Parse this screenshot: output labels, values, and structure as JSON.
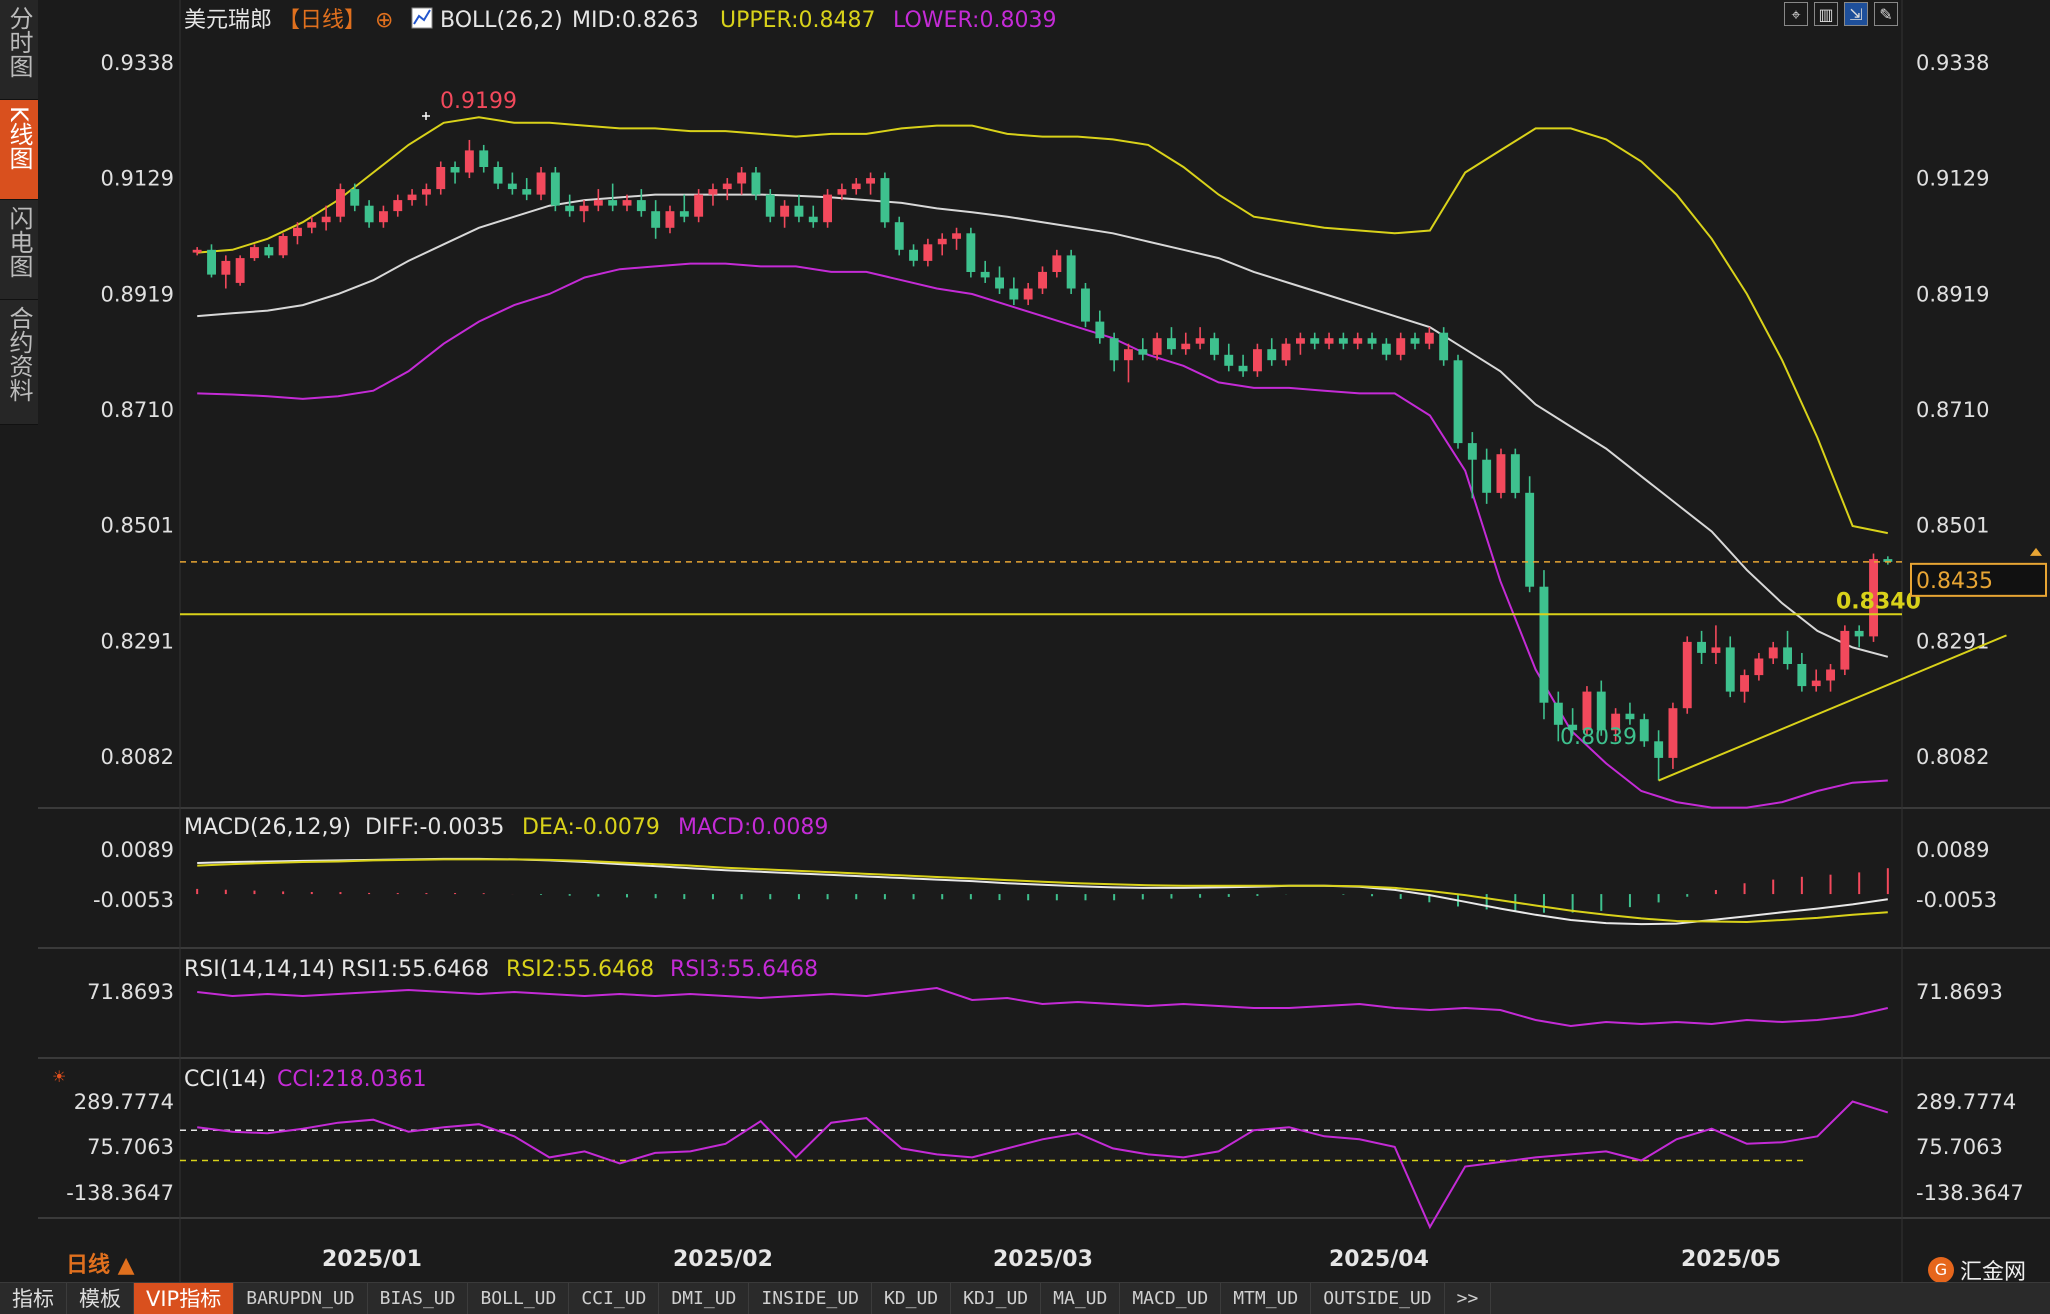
{
  "sidebar": {
    "tabs": [
      {
        "label": "分时图",
        "active": false
      },
      {
        "label": "K线图",
        "active": true
      },
      {
        "label": "闪电图",
        "active": false
      },
      {
        "label": "合约资料",
        "active": false
      }
    ]
  },
  "header": {
    "instrument": "美元瑞郎",
    "period": "【日线】",
    "boll_label": "BOLL(26,2)",
    "boll_mid": "MID:0.8263",
    "boll_upper": "UPPER:0.8487",
    "boll_lower": "LOWER:0.8039"
  },
  "price_axis": {
    "ticks": [
      "0.9338",
      "0.9129",
      "0.8919",
      "0.8710",
      "0.8501",
      "0.8291",
      "0.8082"
    ],
    "current_price": "0.8435",
    "hline_label": "0.8340",
    "high_label": "0.9199",
    "low_label": "0.8039"
  },
  "macd": {
    "title": "MACD(26,12,9)",
    "diff": "DIFF:-0.0035",
    "dea": "DEA:-0.0079",
    "macd": "MACD:0.0089",
    "ticks": [
      "0.0089",
      "-0.0053"
    ]
  },
  "rsi": {
    "title": "RSI(14,14,14)",
    "rsi1": "RSI1:55.6468",
    "rsi2": "RSI2:55.6468",
    "rsi3": "RSI3:55.6468",
    "tick": "71.8693"
  },
  "cci": {
    "title": "CCI(14)",
    "value": "CCI:218.0361",
    "ticks": [
      "289.7774",
      "75.7063",
      "-138.3647"
    ]
  },
  "time_axis": {
    "period_button": "日线 ▲",
    "labels": [
      "2025/01",
      "2025/02",
      "2025/03",
      "2025/04",
      "2025/05"
    ]
  },
  "bottom_bar": {
    "items": [
      "指标",
      "模板",
      "VIP指标",
      "BARUPDN_UD",
      "BIAS_UD",
      "BOLL_UD",
      "CCI_UD",
      "DMI_UD",
      "INSIDE_UD",
      "KD_UD",
      "KDJ_UD",
      "MA_UD",
      "MACD_UD",
      "MTM_UD",
      "OUTSIDE_UD",
      ">>"
    ],
    "active_index": 2
  },
  "logo": {
    "text": "汇金网"
  },
  "colors": {
    "up": "#f2495c",
    "down": "#3ec18e",
    "mid": "#d8d8d8",
    "upper": "#d9d21a",
    "lower": "#c42bd6",
    "accent": "#d9501e",
    "price_line": "#e8a534"
  },
  "chart_data": {
    "type": "candlestick",
    "title": "美元瑞郎 日线",
    "y_range": [
      0.7982,
      0.938
    ],
    "x_labels": [
      "2025/01",
      "2025/02",
      "2025/03",
      "2025/04",
      "2025/05"
    ],
    "candles": [
      [
        0.8995,
        0.9005,
        0.899,
        0.9
      ],
      [
        0.9,
        0.901,
        0.895,
        0.8955
      ],
      [
        0.8955,
        0.899,
        0.893,
        0.898
      ],
      [
        0.894,
        0.899,
        0.8935,
        0.8985
      ],
      [
        0.8985,
        0.901,
        0.898,
        0.9005
      ],
      [
        0.9005,
        0.901,
        0.8985,
        0.899
      ],
      [
        0.899,
        0.903,
        0.8985,
        0.9025
      ],
      [
        0.9025,
        0.905,
        0.901,
        0.904
      ],
      [
        0.904,
        0.906,
        0.903,
        0.905
      ],
      [
        0.905,
        0.908,
        0.9035,
        0.906
      ],
      [
        0.906,
        0.912,
        0.905,
        0.911
      ],
      [
        0.911,
        0.912,
        0.907,
        0.908
      ],
      [
        0.908,
        0.909,
        0.904,
        0.905
      ],
      [
        0.905,
        0.908,
        0.904,
        0.907
      ],
      [
        0.907,
        0.91,
        0.906,
        0.909
      ],
      [
        0.909,
        0.911,
        0.908,
        0.91
      ],
      [
        0.91,
        0.912,
        0.908,
        0.911
      ],
      [
        0.911,
        0.916,
        0.91,
        0.915
      ],
      [
        0.915,
        0.916,
        0.912,
        0.914
      ],
      [
        0.914,
        0.9199,
        0.913,
        0.918
      ],
      [
        0.918,
        0.919,
        0.914,
        0.915
      ],
      [
        0.915,
        0.916,
        0.911,
        0.912
      ],
      [
        0.912,
        0.914,
        0.91,
        0.911
      ],
      [
        0.911,
        0.913,
        0.909,
        0.91
      ],
      [
        0.91,
        0.915,
        0.909,
        0.914
      ],
      [
        0.914,
        0.915,
        0.907,
        0.908
      ],
      [
        0.908,
        0.91,
        0.906,
        0.907
      ],
      [
        0.907,
        0.909,
        0.905,
        0.908
      ],
      [
        0.908,
        0.911,
        0.907,
        0.909
      ],
      [
        0.909,
        0.912,
        0.907,
        0.908
      ],
      [
        0.908,
        0.91,
        0.907,
        0.909
      ],
      [
        0.909,
        0.911,
        0.906,
        0.907
      ],
      [
        0.907,
        0.909,
        0.902,
        0.904
      ],
      [
        0.904,
        0.908,
        0.903,
        0.907
      ],
      [
        0.907,
        0.91,
        0.905,
        0.906
      ],
      [
        0.906,
        0.911,
        0.905,
        0.91
      ],
      [
        0.91,
        0.912,
        0.908,
        0.911
      ],
      [
        0.911,
        0.913,
        0.909,
        0.912
      ],
      [
        0.912,
        0.915,
        0.91,
        0.914
      ],
      [
        0.914,
        0.915,
        0.909,
        0.91
      ],
      [
        0.91,
        0.911,
        0.905,
        0.906
      ],
      [
        0.906,
        0.909,
        0.904,
        0.908
      ],
      [
        0.908,
        0.91,
        0.905,
        0.906
      ],
      [
        0.906,
        0.908,
        0.904,
        0.905
      ],
      [
        0.905,
        0.911,
        0.904,
        0.91
      ],
      [
        0.91,
        0.912,
        0.909,
        0.911
      ],
      [
        0.911,
        0.913,
        0.91,
        0.912
      ],
      [
        0.912,
        0.914,
        0.91,
        0.913
      ],
      [
        0.913,
        0.914,
        0.904,
        0.905
      ],
      [
        0.905,
        0.906,
        0.899,
        0.9
      ],
      [
        0.9,
        0.901,
        0.897,
        0.898
      ],
      [
        0.898,
        0.902,
        0.897,
        0.901
      ],
      [
        0.901,
        0.903,
        0.899,
        0.902
      ],
      [
        0.902,
        0.904,
        0.9,
        0.903
      ],
      [
        0.903,
        0.904,
        0.895,
        0.896
      ],
      [
        0.896,
        0.898,
        0.894,
        0.895
      ],
      [
        0.895,
        0.897,
        0.892,
        0.893
      ],
      [
        0.893,
        0.895,
        0.89,
        0.891
      ],
      [
        0.891,
        0.894,
        0.89,
        0.893
      ],
      [
        0.893,
        0.897,
        0.892,
        0.896
      ],
      [
        0.896,
        0.9,
        0.895,
        0.899
      ],
      [
        0.899,
        0.9,
        0.892,
        0.893
      ],
      [
        0.893,
        0.894,
        0.886,
        0.887
      ],
      [
        0.887,
        0.889,
        0.883,
        0.884
      ],
      [
        0.884,
        0.885,
        0.878,
        0.88
      ],
      [
        0.88,
        0.883,
        0.876,
        0.882
      ],
      [
        0.882,
        0.884,
        0.88,
        0.881
      ],
      [
        0.881,
        0.885,
        0.88,
        0.884
      ],
      [
        0.884,
        0.886,
        0.881,
        0.882
      ],
      [
        0.882,
        0.885,
        0.881,
        0.883
      ],
      [
        0.883,
        0.886,
        0.882,
        0.884
      ],
      [
        0.884,
        0.885,
        0.88,
        0.881
      ],
      [
        0.881,
        0.883,
        0.878,
        0.879
      ],
      [
        0.879,
        0.881,
        0.877,
        0.878
      ],
      [
        0.878,
        0.883,
        0.877,
        0.882
      ],
      [
        0.882,
        0.884,
        0.879,
        0.88
      ],
      [
        0.88,
        0.884,
        0.879,
        0.883
      ],
      [
        0.883,
        0.885,
        0.881,
        0.884
      ],
      [
        0.884,
        0.885,
        0.882,
        0.883
      ],
      [
        0.883,
        0.885,
        0.882,
        0.884
      ],
      [
        0.884,
        0.885,
        0.882,
        0.883
      ],
      [
        0.883,
        0.885,
        0.882,
        0.884
      ],
      [
        0.884,
        0.885,
        0.882,
        0.883
      ],
      [
        0.883,
        0.884,
        0.88,
        0.881
      ],
      [
        0.881,
        0.885,
        0.88,
        0.884
      ],
      [
        0.884,
        0.885,
        0.882,
        0.883
      ],
      [
        0.883,
        0.886,
        0.882,
        0.885
      ],
      [
        0.885,
        0.886,
        0.879,
        0.88
      ],
      [
        0.88,
        0.881,
        0.864,
        0.865
      ],
      [
        0.865,
        0.867,
        0.855,
        0.862
      ],
      [
        0.862,
        0.864,
        0.854,
        0.856
      ],
      [
        0.856,
        0.864,
        0.855,
        0.863
      ],
      [
        0.863,
        0.864,
        0.855,
        0.856
      ],
      [
        0.856,
        0.859,
        0.838,
        0.839
      ],
      [
        0.839,
        0.842,
        0.815,
        0.818
      ],
      [
        0.818,
        0.82,
        0.811,
        0.814
      ],
      [
        0.814,
        0.817,
        0.812,
        0.813
      ],
      [
        0.813,
        0.821,
        0.812,
        0.82
      ],
      [
        0.82,
        0.822,
        0.812,
        0.813
      ],
      [
        0.813,
        0.817,
        0.811,
        0.816
      ],
      [
        0.816,
        0.818,
        0.814,
        0.815
      ],
      [
        0.815,
        0.816,
        0.81,
        0.811
      ],
      [
        0.811,
        0.813,
        0.8039,
        0.808
      ],
      [
        0.808,
        0.818,
        0.806,
        0.817
      ],
      [
        0.817,
        0.83,
        0.816,
        0.829
      ],
      [
        0.829,
        0.831,
        0.825,
        0.827
      ],
      [
        0.827,
        0.832,
        0.825,
        0.828
      ],
      [
        0.828,
        0.83,
        0.819,
        0.82
      ],
      [
        0.82,
        0.824,
        0.818,
        0.823
      ],
      [
        0.823,
        0.827,
        0.822,
        0.826
      ],
      [
        0.826,
        0.829,
        0.825,
        0.828
      ],
      [
        0.828,
        0.831,
        0.824,
        0.825
      ],
      [
        0.825,
        0.827,
        0.82,
        0.821
      ],
      [
        0.821,
        0.824,
        0.82,
        0.822
      ],
      [
        0.822,
        0.825,
        0.82,
        0.824
      ],
      [
        0.824,
        0.832,
        0.823,
        0.831
      ],
      [
        0.831,
        0.832,
        0.828,
        0.83
      ],
      [
        0.83,
        0.845,
        0.829,
        0.844
      ],
      [
        0.844,
        0.8445,
        0.843,
        0.8435
      ]
    ],
    "boll_upper": [
      0.8995,
      0.9,
      0.902,
      0.905,
      0.909,
      0.914,
      0.919,
      0.923,
      0.924,
      0.923,
      0.923,
      0.9225,
      0.922,
      0.922,
      0.9215,
      0.9215,
      0.921,
      0.9205,
      0.921,
      0.921,
      0.922,
      0.9225,
      0.9225,
      0.921,
      0.9205,
      0.9205,
      0.92,
      0.919,
      0.915,
      0.91,
      0.906,
      0.905,
      0.904,
      0.9035,
      0.903,
      0.9035,
      0.914,
      0.918,
      0.922,
      0.922,
      0.92,
      0.916,
      0.91,
      0.902,
      0.892,
      0.88,
      0.866,
      0.85,
      0.8487
    ],
    "boll_mid": [
      0.888,
      0.8885,
      0.889,
      0.89,
      0.892,
      0.8945,
      0.898,
      0.901,
      0.904,
      0.906,
      0.908,
      0.909,
      0.9095,
      0.91,
      0.91,
      0.91,
      0.91,
      0.9098,
      0.9095,
      0.909,
      0.9085,
      0.9075,
      0.9068,
      0.906,
      0.905,
      0.904,
      0.903,
      0.9015,
      0.9,
      0.8985,
      0.896,
      0.894,
      0.892,
      0.89,
      0.888,
      0.886,
      0.882,
      0.878,
      0.872,
      0.868,
      0.864,
      0.859,
      0.854,
      0.849,
      0.842,
      0.836,
      0.831,
      0.828,
      0.8263
    ],
    "boll_lower": [
      0.874,
      0.8738,
      0.8735,
      0.873,
      0.8735,
      0.8745,
      0.878,
      0.883,
      0.887,
      0.89,
      0.892,
      0.895,
      0.8965,
      0.897,
      0.8975,
      0.8975,
      0.897,
      0.897,
      0.896,
      0.896,
      0.8945,
      0.893,
      0.892,
      0.89,
      0.888,
      0.886,
      0.884,
      0.881,
      0.879,
      0.876,
      0.875,
      0.875,
      0.8745,
      0.874,
      0.874,
      0.87,
      0.86,
      0.84,
      0.824,
      0.813,
      0.807,
      0.802,
      0.8,
      0.799,
      0.799,
      0.8,
      0.802,
      0.8035,
      0.8039
    ],
    "hline": 0.834,
    "last_price": 0.8435,
    "trendline": [
      [
        102,
        0.8039
      ],
      [
        120,
        0.8291
      ]
    ],
    "macd_series": {
      "diff": [
        0.006,
        0.0062,
        0.0063,
        0.0064,
        0.0065,
        0.0066,
        0.0067,
        0.0068,
        0.0068,
        0.0067,
        0.0065,
        0.0062,
        0.0058,
        0.0054,
        0.005,
        0.0046,
        0.0043,
        0.004,
        0.0037,
        0.0034,
        0.0031,
        0.0028,
        0.0025,
        0.0021,
        0.0018,
        0.0015,
        0.0013,
        0.0012,
        0.0012,
        0.0013,
        0.0014,
        0.0016,
        0.0016,
        0.0014,
        0.0008,
        -0.0002,
        -0.0015,
        -0.0028,
        -0.004,
        -0.005,
        -0.0056,
        -0.0058,
        -0.0057,
        -0.005,
        -0.0043,
        -0.0035,
        -0.0028,
        -0.002,
        -0.001
      ],
      "dea": [
        0.0055,
        0.0058,
        0.006,
        0.0062,
        0.0063,
        0.0065,
        0.0066,
        0.0067,
        0.0067,
        0.0067,
        0.0066,
        0.0064,
        0.0061,
        0.0058,
        0.0055,
        0.0051,
        0.0048,
        0.0045,
        0.0042,
        0.0039,
        0.0036,
        0.0033,
        0.003,
        0.0027,
        0.0024,
        0.0021,
        0.0019,
        0.0017,
        0.0016,
        0.0016,
        0.0016,
        0.0016,
        0.0016,
        0.0015,
        0.0012,
        0.0006,
        -0.0002,
        -0.0012,
        -0.0022,
        -0.0032,
        -0.004,
        -0.0047,
        -0.0052,
        -0.0053,
        -0.0054,
        -0.005,
        -0.0046,
        -0.004,
        -0.0035
      ],
      "hist_range": [
        -0.0108,
        0.0089
      ]
    },
    "rsi_series": [
      64,
      62,
      63,
      62,
      63,
      64,
      65,
      64,
      63,
      64,
      63,
      62,
      63,
      62,
      63,
      62,
      61,
      62,
      63,
      62,
      64,
      66,
      60,
      61,
      58,
      59,
      58,
      57,
      58,
      57,
      56,
      56,
      57,
      58,
      56,
      55,
      56,
      55,
      50,
      47,
      49,
      48,
      49,
      48,
      50,
      49,
      50,
      52,
      56
    ],
    "cci_series": [
      120,
      90,
      80,
      110,
      150,
      170,
      90,
      120,
      140,
      60,
      -80,
      -40,
      -120,
      -50,
      -40,
      10,
      160,
      -80,
      150,
      180,
      -20,
      -60,
      -80,
      -20,
      40,
      80,
      -20,
      -60,
      -80,
      -40,
      100,
      120,
      60,
      40,
      -10,
      -540,
      -140,
      -110,
      -80,
      -60,
      -40,
      -100,
      40,
      110,
      10,
      20,
      60,
      290,
      218
    ],
    "cci_levels": [
      100,
      -100
    ]
  }
}
